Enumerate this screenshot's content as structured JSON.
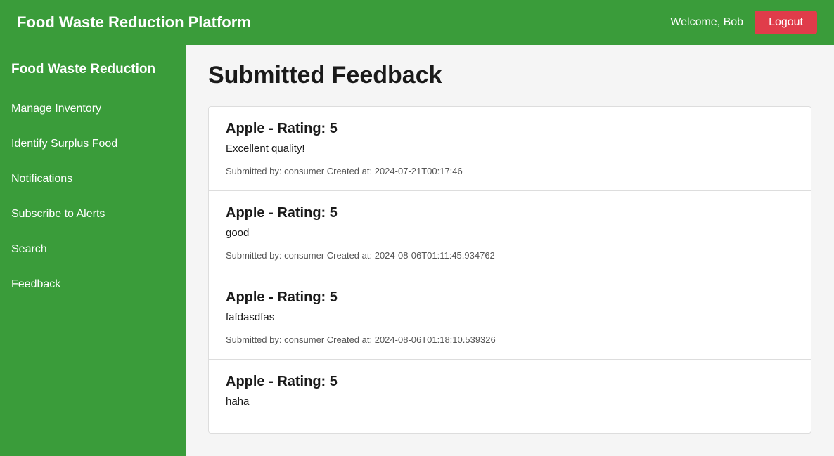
{
  "header": {
    "title": "Food Waste Reduction Platform",
    "welcome": "Welcome, Bob",
    "logout_label": "Logout"
  },
  "sidebar": {
    "brand": "Food Waste Reduction",
    "items": [
      {
        "id": "manage-inventory",
        "label": "Manage Inventory"
      },
      {
        "id": "identify-surplus-food",
        "label": "Identify Surplus Food"
      },
      {
        "id": "notifications",
        "label": "Notifications"
      },
      {
        "id": "subscribe-to-alerts",
        "label": "Subscribe to Alerts"
      },
      {
        "id": "search",
        "label": "Search"
      },
      {
        "id": "feedback",
        "label": "Feedback"
      }
    ]
  },
  "main": {
    "page_title": "Submitted Feedback",
    "feedback_items": [
      {
        "title": "Apple - Rating: 5",
        "comment": "Excellent quality!",
        "meta": "Submitted by: consumer Created at: 2024-07-21T00:17:46"
      },
      {
        "title": "Apple - Rating: 5",
        "comment": "good",
        "meta": "Submitted by: consumer Created at: 2024-08-06T01:11:45.934762"
      },
      {
        "title": "Apple - Rating: 5",
        "comment": "fafdasdfas",
        "meta": "Submitted by: consumer Created at: 2024-08-06T01:18:10.539326"
      },
      {
        "title": "Apple - Rating: 5",
        "comment": "haha",
        "meta": ""
      }
    ]
  }
}
